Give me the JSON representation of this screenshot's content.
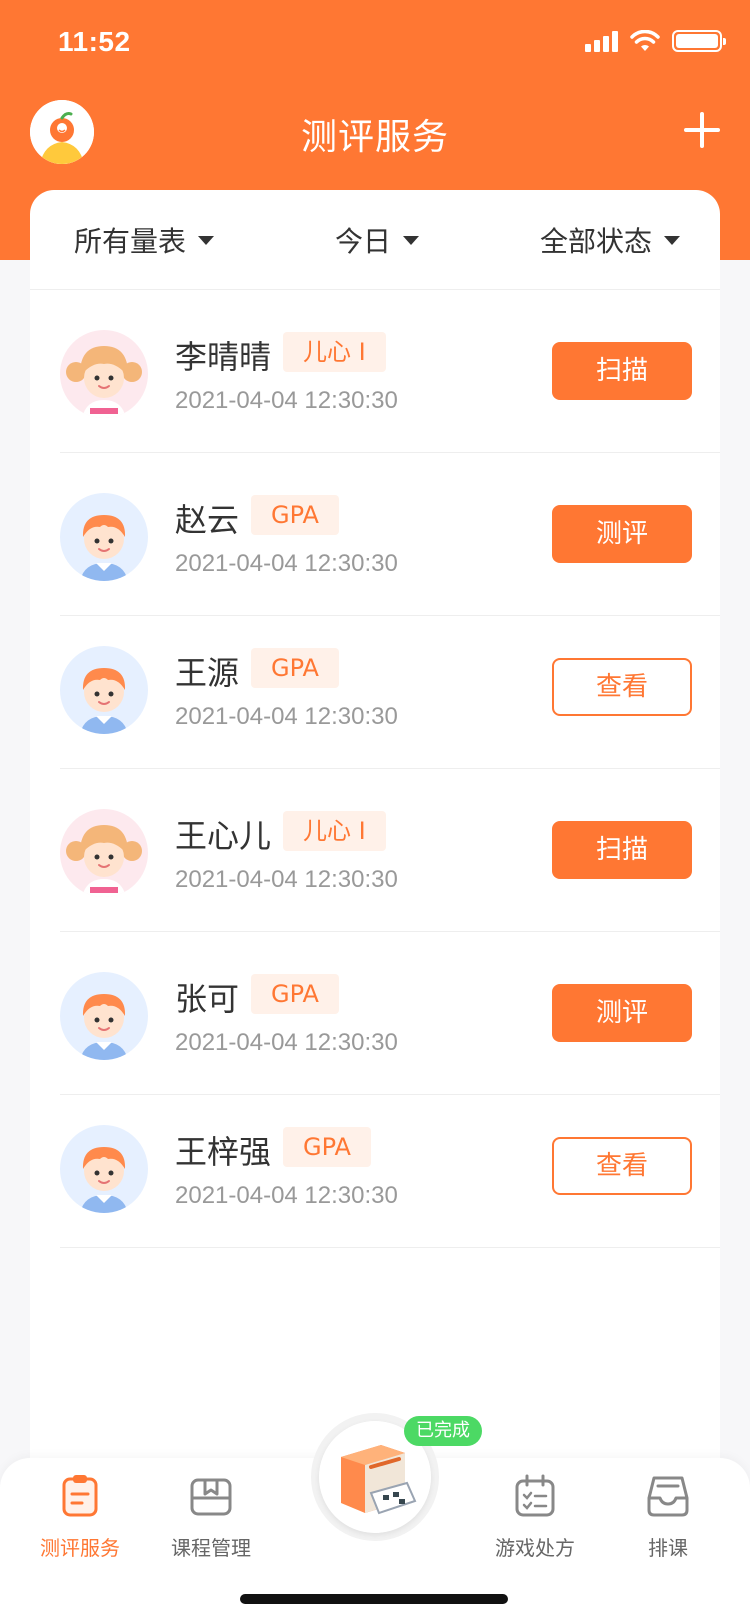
{
  "status_bar": {
    "time": "11:52"
  },
  "nav": {
    "title": "测评服务",
    "add_icon": "plus-icon",
    "logo_icon": "peach-logo-icon"
  },
  "filters": [
    {
      "label": "所有量表"
    },
    {
      "label": "今日"
    },
    {
      "label": "全部状态"
    }
  ],
  "records": [
    {
      "name": "李晴晴",
      "tag": "儿心 I",
      "time": "2021-04-04  12:30:30",
      "avatar": "girl-avatar",
      "action": "扫描",
      "style": "filled"
    },
    {
      "name": "赵云",
      "tag": "GPA",
      "time": "2021-04-04  12:30:30",
      "avatar": "boy-avatar",
      "action": "测评",
      "style": "filled"
    },
    {
      "name": "王源",
      "tag": "GPA",
      "time": "2021-04-04  12:30:30",
      "avatar": "boy-avatar",
      "action": "查看",
      "style": "outline"
    },
    {
      "name": "王心儿",
      "tag": "儿心 I",
      "time": "2021-04-04  12:30:30",
      "avatar": "girl-avatar",
      "action": "扫描",
      "style": "filled"
    },
    {
      "name": "张可",
      "tag": "GPA",
      "time": "2021-04-04  12:30:30",
      "avatar": "boy-avatar",
      "action": "测评",
      "style": "filled"
    },
    {
      "name": "王梓强",
      "tag": "GPA",
      "time": "2021-04-04  12:30:30",
      "avatar": "boy-avatar",
      "action": "查看",
      "style": "outline"
    }
  ],
  "tabbar": {
    "tabs": [
      {
        "label": "测评服务",
        "icon": "clipboard-icon",
        "active": true
      },
      {
        "label": "课程管理",
        "icon": "folder-icon",
        "active": false
      },
      {
        "label": "游戏处方",
        "icon": "calendar-check-icon",
        "active": false
      },
      {
        "label": "排课",
        "icon": "inbox-icon",
        "active": false
      }
    ],
    "center_badge": "已完成",
    "center_icon": "scanner-box-icon"
  },
  "colors": {
    "accent": "#ff7733",
    "success": "#4cd964",
    "tag_bg": "#fff1e9"
  }
}
